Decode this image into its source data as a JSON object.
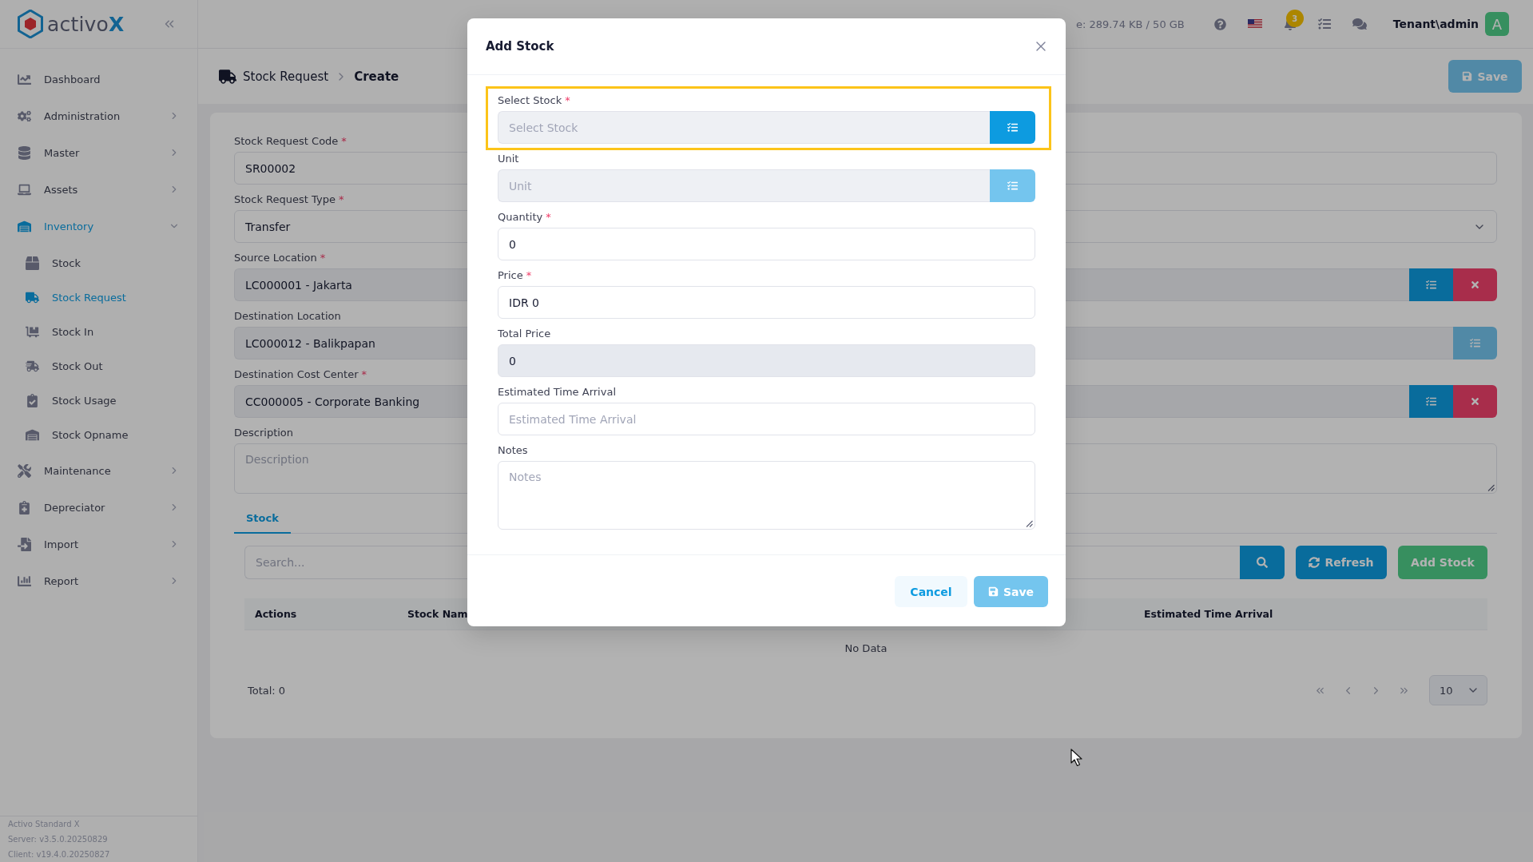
{
  "sidebar": {
    "logo": {
      "name": "activo",
      "accent": "X"
    },
    "items": [
      {
        "label": "Dashboard",
        "selected": false
      },
      {
        "label": "Administration",
        "selected": false,
        "expanded": false
      },
      {
        "label": "Master",
        "selected": false,
        "expanded": false
      },
      {
        "label": "Assets",
        "selected": false,
        "expanded": false
      },
      {
        "label": "Inventory",
        "selected": true,
        "expanded": true,
        "children": [
          {
            "label": "Stock",
            "selected": false
          },
          {
            "label": "Stock Request",
            "selected": true
          },
          {
            "label": "Stock In",
            "selected": false
          },
          {
            "label": "Stock Out",
            "selected": false
          },
          {
            "label": "Stock Usage",
            "selected": false
          },
          {
            "label": "Stock Opname",
            "selected": false
          }
        ]
      },
      {
        "label": "Maintenance",
        "selected": false,
        "expanded": false
      },
      {
        "label": "Depreciator",
        "selected": false,
        "expanded": false
      },
      {
        "label": "Import",
        "selected": false,
        "expanded": false
      },
      {
        "label": "Report",
        "selected": false,
        "expanded": false
      }
    ],
    "version_info": [
      "Activo Standard X",
      "Server: v3.5.0.20250829",
      "Client: v19.4.0.20250827"
    ]
  },
  "top_bar": {
    "storage": "e: 289.74 KB / 50 GB",
    "notification_count": "3",
    "user": "Tenant\\admin",
    "avatar": "A"
  },
  "page_header": {
    "breadcrumb": [
      "Stock Request",
      "Create"
    ],
    "save": {
      "label": "Save",
      "disabled": true
    }
  },
  "form": {
    "fields": [
      {
        "kind": "text",
        "label": "Stock Request Code",
        "required_mark": "*",
        "value": "SR00002",
        "readonly": false
      },
      {
        "kind": "select",
        "label": "Stock Request Type",
        "required_mark": "*",
        "value": "Transfer"
      },
      {
        "kind": "lookup",
        "label": "Source Location",
        "required_mark": "*",
        "value": "LC000001 - Jakarta",
        "clearable": true,
        "disabled": false
      },
      {
        "kind": "lookup",
        "label": "Destination Location",
        "value": "LC000012 - Balikpapan",
        "clearable": false,
        "disabled": true
      },
      {
        "kind": "lookup",
        "label": "Destination Cost Center",
        "required_mark": "*",
        "value": "CC000005 - Corporate Banking",
        "clearable": true,
        "disabled": false
      },
      {
        "kind": "textarea",
        "label": "Description",
        "placeholder": "Description"
      }
    ]
  },
  "tabs": [
    {
      "label": "Stock",
      "selected": true
    }
  ],
  "stock_table": {
    "search": {
      "placeholder": "Search..."
    },
    "buttons": [
      {
        "kind": "refresh",
        "label": "Refresh"
      },
      {
        "kind": "add",
        "label": "Add Stock"
      }
    ],
    "columns": [
      "Actions",
      "Stock Nam",
      "Estimated Time Arrival"
    ],
    "empty_text": "No Data",
    "total": "Total: 0",
    "page_size": "10"
  },
  "modal": {
    "title": "Add Stock",
    "fields": [
      {
        "kind": "lookup",
        "label": "Select Stock",
        "required_mark": "*",
        "placeholder": "Select Stock",
        "clearable": false,
        "disabled": false,
        "highlighted": true
      },
      {
        "kind": "lookup",
        "label": "Unit",
        "placeholder": "Unit",
        "clearable": false,
        "disabled": true,
        "highlighted": false
      },
      {
        "kind": "text",
        "label": "Quantity",
        "required_mark": "*",
        "value": "0",
        "readonly": false,
        "highlighted": false
      },
      {
        "kind": "text",
        "label": "Price",
        "required_mark": "*",
        "value": "IDR 0",
        "readonly": false,
        "highlighted": false
      },
      {
        "kind": "text",
        "label": "Total Price",
        "value": "0",
        "readonly": true,
        "highlighted": false
      },
      {
        "kind": "text",
        "label": "Estimated Time Arrival",
        "placeholder": "Estimated Time Arrival",
        "readonly": false,
        "highlighted": false
      },
      {
        "kind": "textarea",
        "label": "Notes",
        "placeholder": "Notes",
        "highlighted": false
      }
    ],
    "buttons": [
      {
        "kind": "cancel",
        "label": "Cancel",
        "disabled": false
      },
      {
        "kind": "save",
        "label": "Save",
        "disabled": true
      }
    ]
  }
}
